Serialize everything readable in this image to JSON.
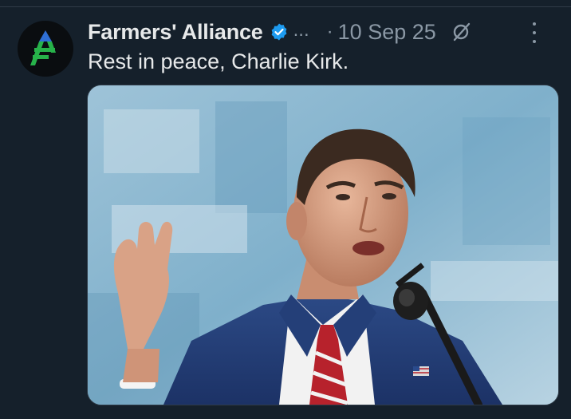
{
  "post": {
    "author": {
      "display_name": "Farmers' Alliance",
      "avatar_icon": "farmers-alliance-logo",
      "verified_icon": "verified-badge-icon"
    },
    "truncation": "...",
    "separator": "·",
    "timestamp": "10 Sep 25",
    "grok_icon": "grok-icon",
    "more_icon": "more-options-icon",
    "text": "Rest in peace, Charlie Kirk.",
    "media": {
      "type": "photo",
      "subject": "man in navy suit speaking at microphone"
    }
  },
  "colors": {
    "background": "#15202b",
    "text_primary": "#e7e9ea",
    "text_secondary": "#8b98a5",
    "verified_blue": "#1d9bf0"
  }
}
